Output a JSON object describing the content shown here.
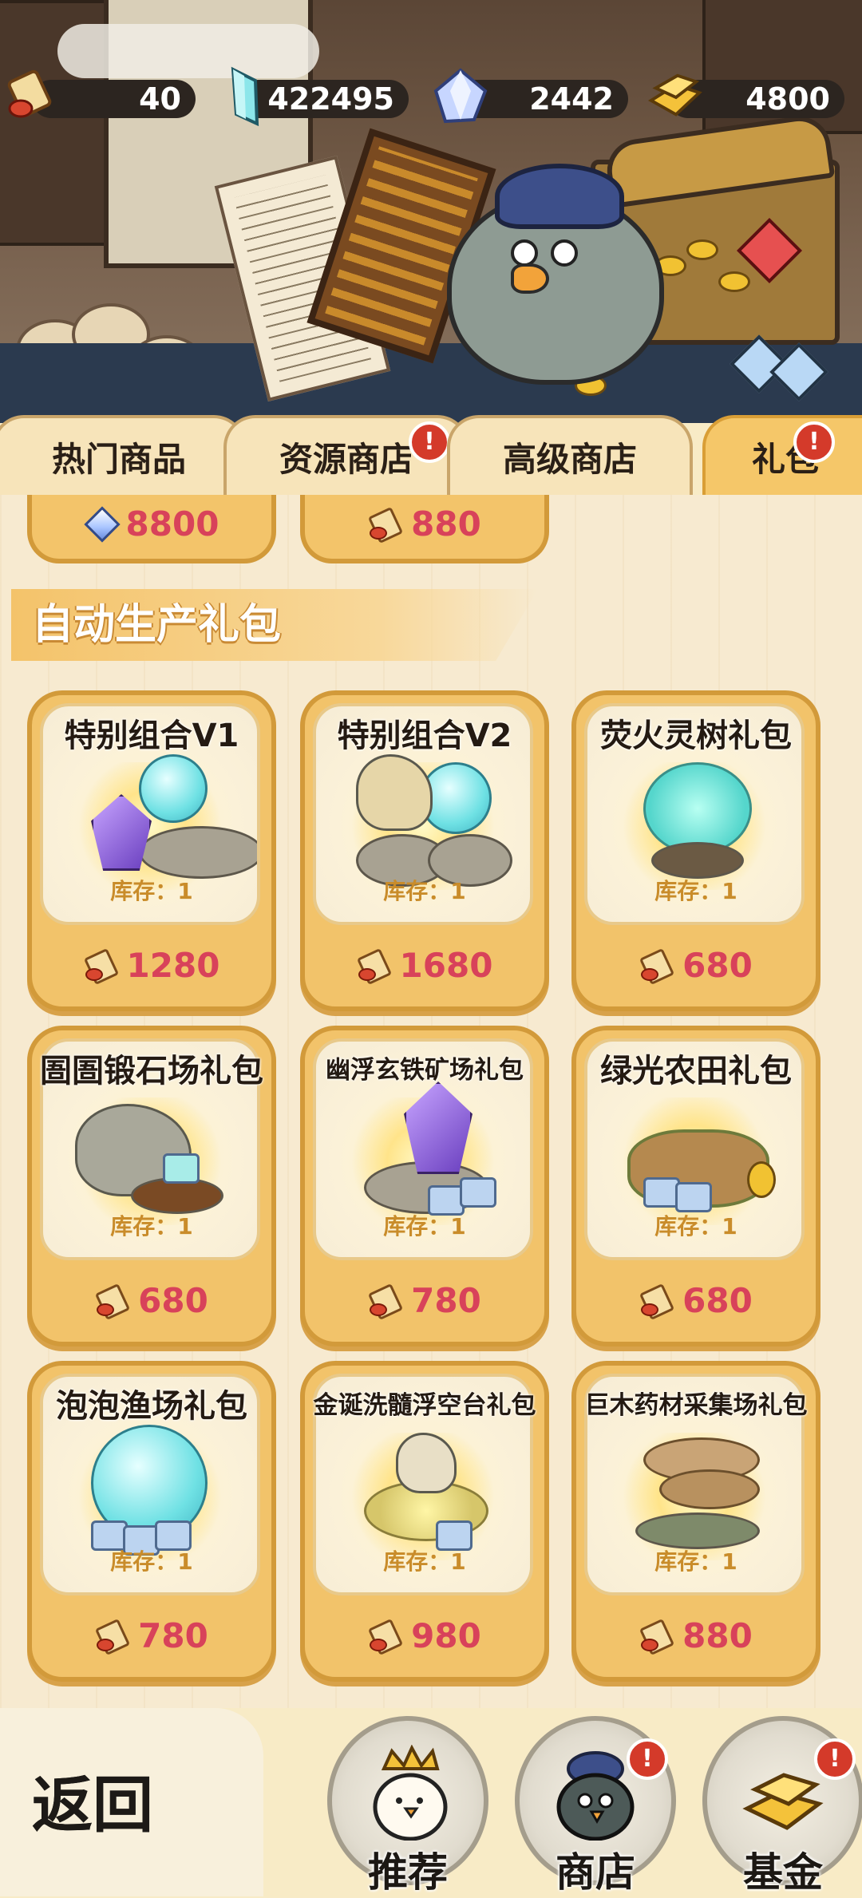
{
  "resources": [
    {
      "icon": "scroll-ticket-icon",
      "value": "40"
    },
    {
      "icon": "blue-crystal-icon",
      "value": "422495"
    },
    {
      "icon": "diamond-icon",
      "value": "2442"
    },
    {
      "icon": "gold-ingot-icon",
      "value": "4800"
    }
  ],
  "tabs": [
    {
      "label": "热门商品",
      "badge": false
    },
    {
      "label": "资源商店",
      "badge": true
    },
    {
      "label": "高级商店",
      "badge": false
    },
    {
      "label": "礼包",
      "badge": true,
      "active": true
    }
  ],
  "badge_mark": "!",
  "top_row": [
    {
      "icon": "diamond-icon",
      "price": "8800"
    },
    {
      "icon": "scroll-ticket-icon",
      "price": "880"
    }
  ],
  "section_title": "自动生产礼包",
  "stock_label": "库存：1",
  "packs": [
    {
      "name": "特别组合V1",
      "price": "1280",
      "art": "crystal-combo"
    },
    {
      "name": "特别组合V2",
      "price": "1680",
      "art": "orb-combo"
    },
    {
      "name": "荧火灵树礼包",
      "price": "680",
      "art": "spirit-tree"
    },
    {
      "name": "圄圄锻石场礼包",
      "price": "680",
      "art": "stone-forge"
    },
    {
      "name": "幽浮玄铁矿场礼包",
      "price": "780",
      "art": "iron-mine"
    },
    {
      "name": "绿光农田礼包",
      "price": "680",
      "art": "farm-field"
    },
    {
      "name": "泡泡渔场礼包",
      "price": "780",
      "art": "bubble-fishery"
    },
    {
      "name": "金诞洗髓浮空台礼包",
      "price": "980",
      "art": "floating-platform"
    },
    {
      "name": "巨木药材采集场礼包",
      "price": "880",
      "art": "herb-mushroom"
    }
  ],
  "bottom_nav": {
    "back_label": "返回",
    "items": [
      {
        "label": "推荐",
        "badge": false,
        "icon": "crowned-chick-icon"
      },
      {
        "label": "商店",
        "badge": true,
        "icon": "merchant-bird-icon"
      },
      {
        "label": "基金",
        "badge": true,
        "icon": "gold-bars-icon"
      }
    ]
  },
  "colors": {
    "price_text": "#d8425a",
    "card_frame": "#f2c36a",
    "badge": "#d43a2a",
    "active_tab": "#f5c769"
  }
}
